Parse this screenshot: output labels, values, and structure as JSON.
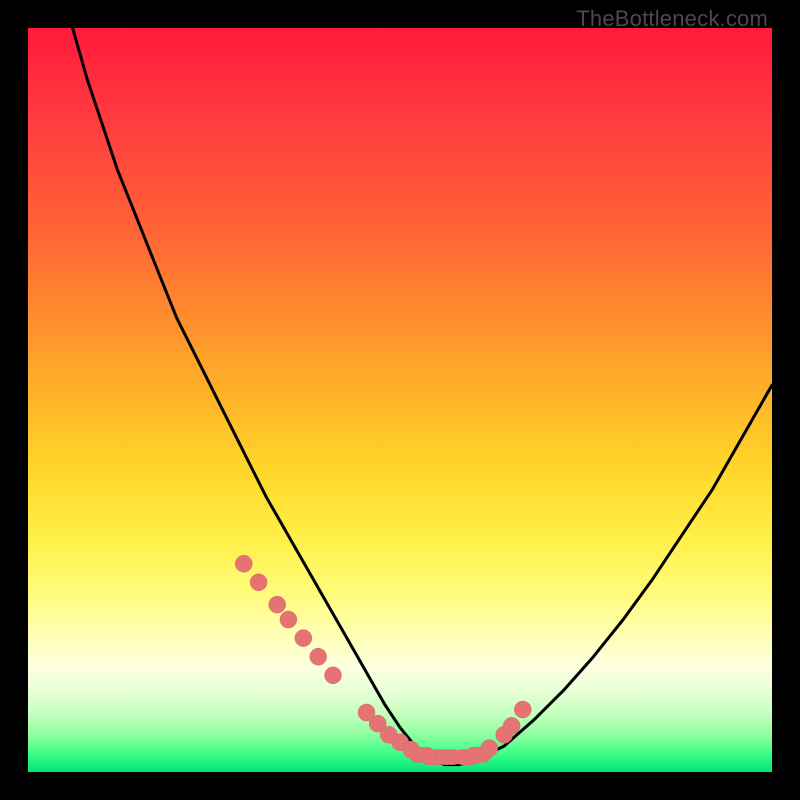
{
  "watermark": "TheBottleneck.com",
  "colors": {
    "background": "#000000",
    "curve": "#000000",
    "marker_fill": "#e57373",
    "marker_stroke": "#d86a6a"
  },
  "chart_data": {
    "type": "line",
    "title": "",
    "xlabel": "",
    "ylabel": "",
    "xlim": [
      0,
      100
    ],
    "ylim": [
      0,
      100
    ],
    "series": [
      {
        "name": "bottleneck-curve",
        "x": [
          6,
          8,
          10,
          12,
          14,
          16,
          18,
          20,
          22,
          24,
          26,
          28,
          30,
          32,
          34,
          36,
          38,
          40,
          42,
          44,
          46,
          48,
          50,
          52,
          54,
          56,
          58,
          60,
          64,
          68,
          72,
          76,
          80,
          84,
          88,
          92,
          96,
          100
        ],
        "values": [
          100,
          93,
          87,
          81,
          76,
          71,
          66,
          61,
          57,
          53,
          49,
          45,
          41,
          37,
          33.5,
          30,
          26.5,
          23,
          19.5,
          16,
          12.5,
          9,
          6,
          3.5,
          1.8,
          1,
          1,
          1.5,
          3.5,
          7,
          11,
          15.5,
          20.5,
          26,
          32,
          38,
          45,
          52
        ]
      }
    ],
    "markers": {
      "name": "highlighted-points",
      "x": [
        29,
        31,
        33.5,
        35,
        37,
        39,
        41,
        45.5,
        47,
        48.5,
        50,
        51.5,
        53,
        54.5,
        56.5,
        59,
        60.5,
        62,
        64,
        65,
        66.5
      ],
      "values": [
        28,
        25.5,
        22.5,
        20.5,
        18,
        15.5,
        13,
        8,
        6.5,
        5,
        4,
        3,
        2.3,
        2,
        2,
        2,
        2.3,
        3.2,
        5,
        6.2,
        8.4
      ]
    }
  }
}
